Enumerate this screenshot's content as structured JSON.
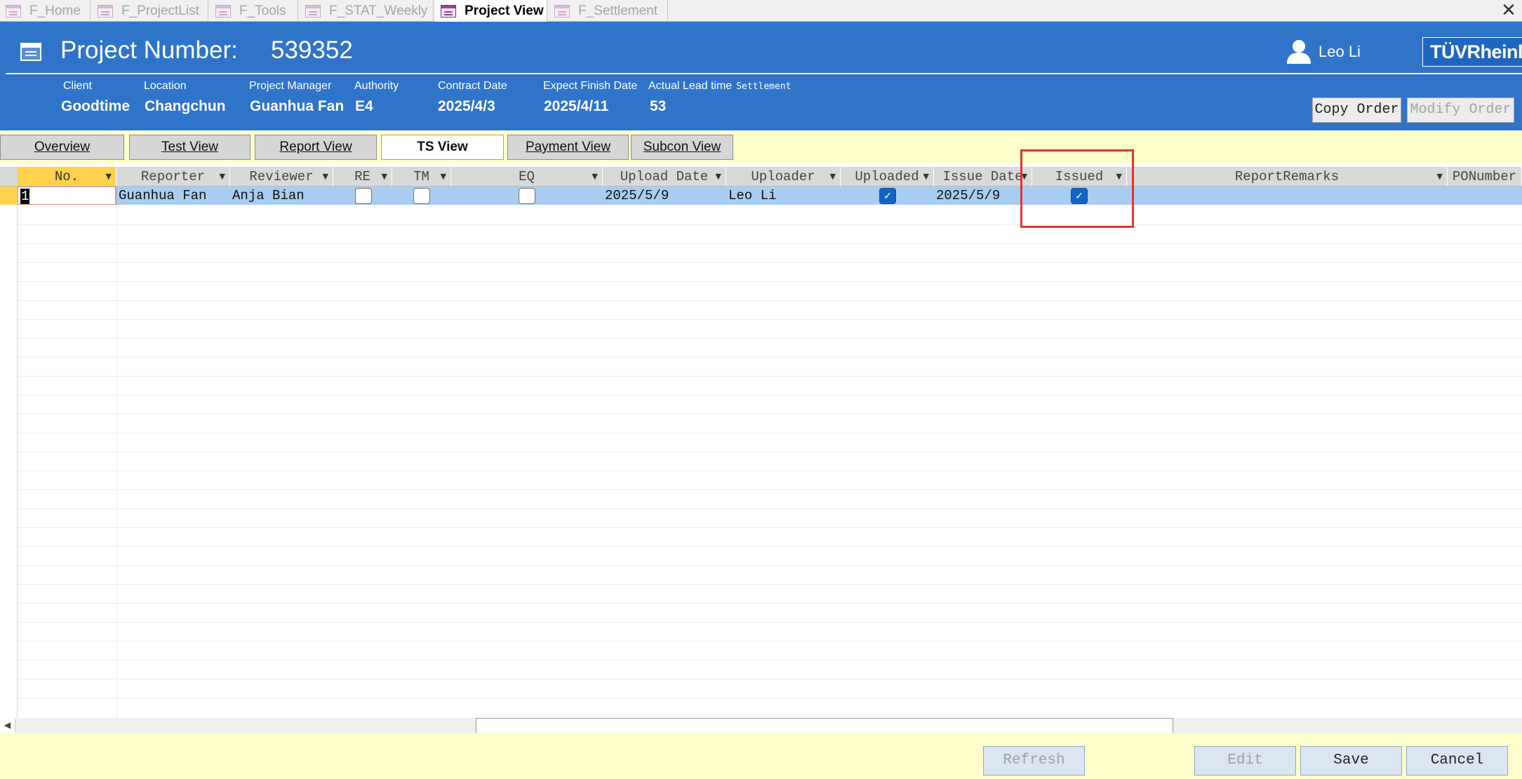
{
  "tabs": [
    {
      "label": "F_Home",
      "active": false
    },
    {
      "label": "F_ProjectList",
      "active": false
    },
    {
      "label": "F_Tools",
      "active": false
    },
    {
      "label": "F_STAT_Weekly",
      "active": false
    },
    {
      "label": "Project View",
      "active": true
    },
    {
      "label": "F_Settlement",
      "active": false
    }
  ],
  "close_glyph": "✕",
  "header": {
    "project_label": "Project Number:",
    "project_number": "539352",
    "user_name": "Leo Li",
    "logo_text": "TÜVRheinland",
    "fields": {
      "client": {
        "label": "Client",
        "value": "Goodtime"
      },
      "location": {
        "label": "Location",
        "value": "Changchun"
      },
      "project_manager": {
        "label": "Project Manager",
        "value": "Guanhua Fan"
      },
      "authority": {
        "label": "Authority",
        "value": "E4"
      },
      "contract_date": {
        "label": "Contract Date",
        "value": "2025/4/3"
      },
      "expect_finish": {
        "label": "Expect Finish Date",
        "value": "2025/4/11"
      },
      "lead_time": {
        "label": "Actual Lead time",
        "value": "53",
        "extra": "Settlement"
      }
    },
    "buttons": {
      "copy_order": "Copy Order",
      "modify_order": "Modify Order"
    },
    "accent": "#2f74c9"
  },
  "view_tabs": [
    "Overview",
    "Test View",
    "Report View",
    "TS View",
    "Payment View",
    "Subcon View"
  ],
  "active_view": "TS View",
  "grid": {
    "columns": [
      "No.",
      "Reporter",
      "Reviewer",
      "RE",
      "TM",
      "EQ",
      "Upload Date",
      "Uploader",
      "Uploaded",
      "Issue Date",
      "Issued",
      "ReportRemarks",
      "PONumber"
    ],
    "row": {
      "no": "1",
      "reporter": "Guanhua Fan",
      "reviewer": "Anja Bian",
      "re": false,
      "tm": false,
      "eq": false,
      "upload_date": "2025/5/9",
      "uploader": "Leo Li",
      "uploaded": true,
      "issue_date": "2025/5/9",
      "issued": true,
      "report_remarks": "",
      "po_number": ""
    },
    "dropdown_glyph": "▼",
    "check_glyph": "✓"
  },
  "footer": {
    "refresh": "Refresh",
    "edit": "Edit",
    "save": "Save",
    "cancel": "Cancel"
  },
  "scroll_left_glyph": "◀"
}
